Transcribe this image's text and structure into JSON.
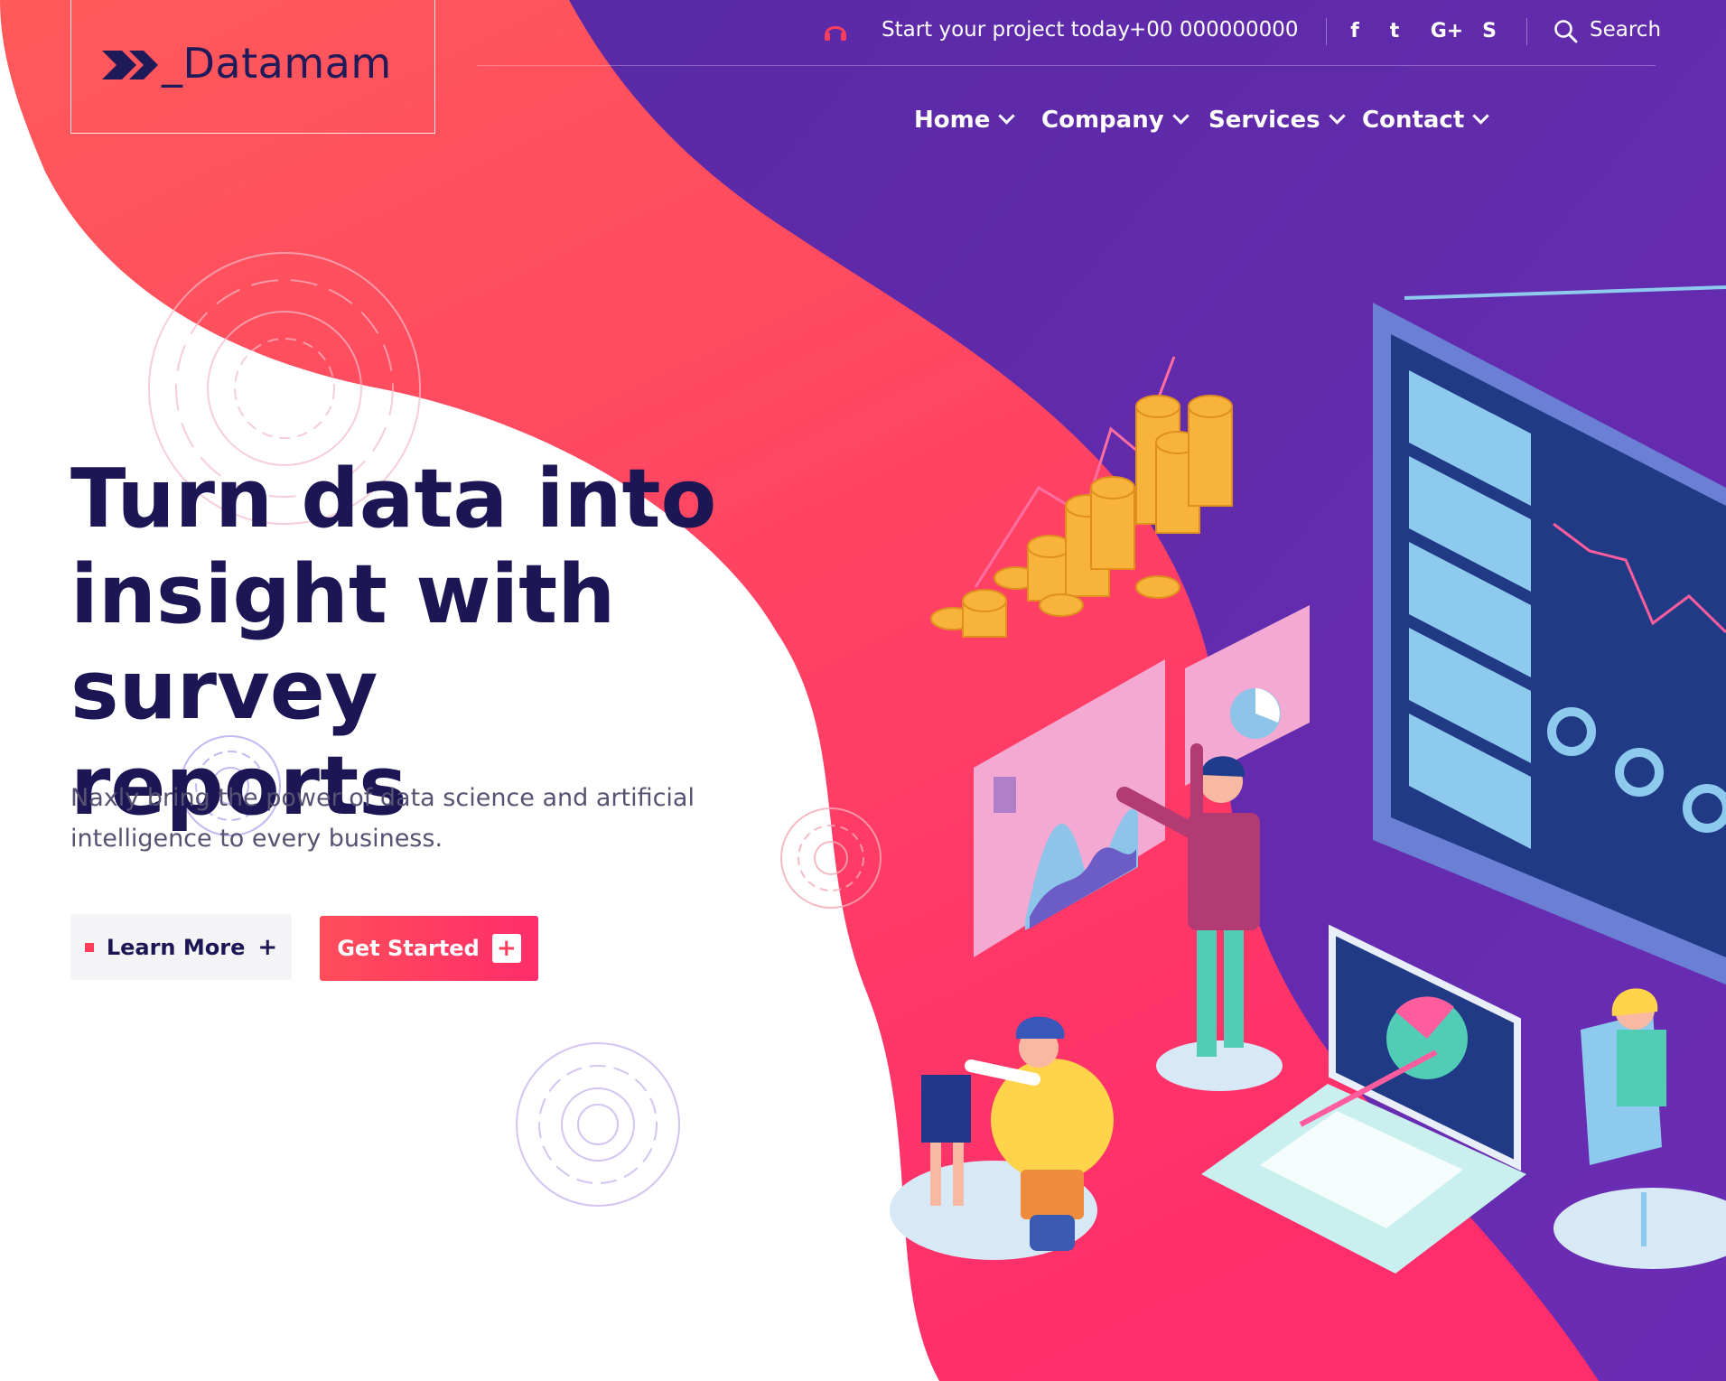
{
  "brand": {
    "name": "_Datamam"
  },
  "topbar": {
    "cta": "Start your project today",
    "phone": "+00 000000000",
    "socials": [
      {
        "icon": "facebook-icon",
        "glyph": "f"
      },
      {
        "icon": "twitter-icon",
        "glyph": "t"
      },
      {
        "icon": "google-plus-icon",
        "glyph": "G+"
      },
      {
        "icon": "skype-icon",
        "glyph": "S"
      }
    ],
    "search_label": "Search"
  },
  "nav": {
    "items": [
      {
        "label": "Home"
      },
      {
        "label": "Company"
      },
      {
        "label": "Services"
      },
      {
        "label": "Contact"
      }
    ]
  },
  "hero": {
    "title_lines": [
      "Turn data into",
      "insight with survey",
      "reports"
    ],
    "subtitle_lines": [
      "Naxly bring the power of data science and artificial",
      "intelligence to every business."
    ],
    "learn_more": "Learn More",
    "get_started": "Get Started"
  },
  "colors": {
    "coral": "#ff4f5e",
    "purple": "#5e2aa8",
    "navy": "#1c1654",
    "accent": "#ff3e5b"
  }
}
